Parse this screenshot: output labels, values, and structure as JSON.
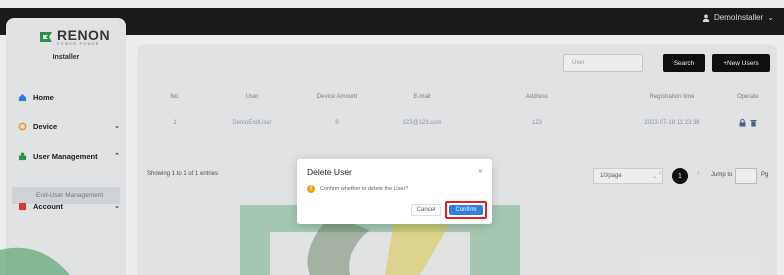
{
  "header": {
    "user_name": "DemoInstaller",
    "caret": "⌄"
  },
  "sidebar": {
    "logo_word": "RENON",
    "logo_sub": "POWER POWER",
    "role": "Installer",
    "items": [
      {
        "label": "Home",
        "icon": "home-icon",
        "color": "#3b82f6"
      },
      {
        "label": "Device",
        "icon": "device-icon",
        "color": "#f5a623",
        "chevron": "⌄"
      },
      {
        "label": "User Management",
        "icon": "user-management-icon",
        "color": "#2e9e4f",
        "chevron": "⌃"
      },
      {
        "label": "Account",
        "icon": "account-icon",
        "color": "#e04040",
        "chevron": "⌄"
      }
    ],
    "sub_item": "End-User Management"
  },
  "toolbar": {
    "search_placeholder": "User",
    "search_label": "Search",
    "new_users_label": "+New Users"
  },
  "table": {
    "columns": [
      "No.",
      "User",
      "Device Amount",
      "E-mail",
      "Address",
      "Registration time",
      "Operate"
    ],
    "rows": [
      [
        "1",
        "DemoEndUser",
        "0",
        "123@123.com",
        "123",
        "2023-07-18 11:23:36"
      ]
    ]
  },
  "pagination": {
    "info": "Showing 1 to 1 of 1 entries",
    "page_size": "10/page",
    "current_page": "1",
    "jump_label": "Jump to",
    "jump_unit": "Pg"
  },
  "dialog": {
    "title": "Delete User",
    "message": "Confirm whether to delete the User?",
    "cancel_label": "Cancel",
    "confirm_label": "Confirm",
    "warn_glyph": "!",
    "close_glyph": "×"
  },
  "colors": {
    "brand_green": "#2e9e4f",
    "confirm_blue": "#2f7de1",
    "highlight_red": "#e02424",
    "topbar": "#1d1d1f"
  }
}
